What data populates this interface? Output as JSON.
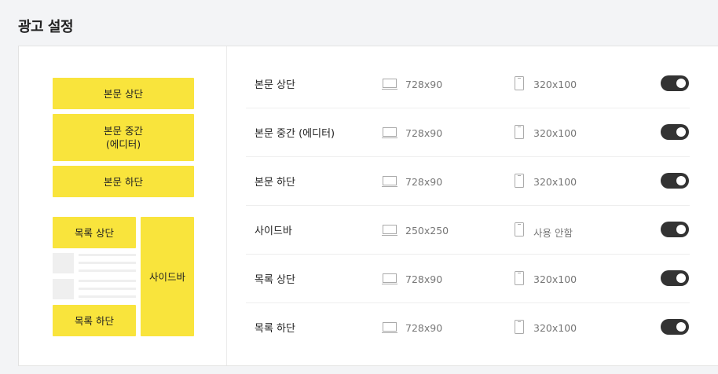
{
  "page": {
    "title": "광고 설정"
  },
  "preview": {
    "body_top": "본문 상단",
    "body_middle_line1": "본문 중간",
    "body_middle_line2": "(에디터)",
    "body_bottom": "본문 하단",
    "list_top": "목록 상단",
    "sidebar": "사이드바",
    "list_bottom": "목록 하단"
  },
  "ad_slots": [
    {
      "name": "본문 상단",
      "desktop_size": "728x90",
      "mobile_size": "320x100",
      "enabled": true
    },
    {
      "name": "본문 중간 (에디터)",
      "desktop_size": "728x90",
      "mobile_size": "320x100",
      "enabled": true
    },
    {
      "name": "본문 하단",
      "desktop_size": "728x90",
      "mobile_size": "320x100",
      "enabled": true
    },
    {
      "name": "사이드바",
      "desktop_size": "250x250",
      "mobile_size": "사용 안함",
      "enabled": true
    },
    {
      "name": "목록 상단",
      "desktop_size": "728x90",
      "mobile_size": "320x100",
      "enabled": true
    },
    {
      "name": "목록 하단",
      "desktop_size": "728x90",
      "mobile_size": "320x100",
      "enabled": true
    }
  ],
  "colors": {
    "ad_block": "#f9e43c",
    "toggle_on": "#333333"
  },
  "icons": {
    "desktop": "monitor-icon",
    "mobile": "mobile-phone-icon"
  }
}
